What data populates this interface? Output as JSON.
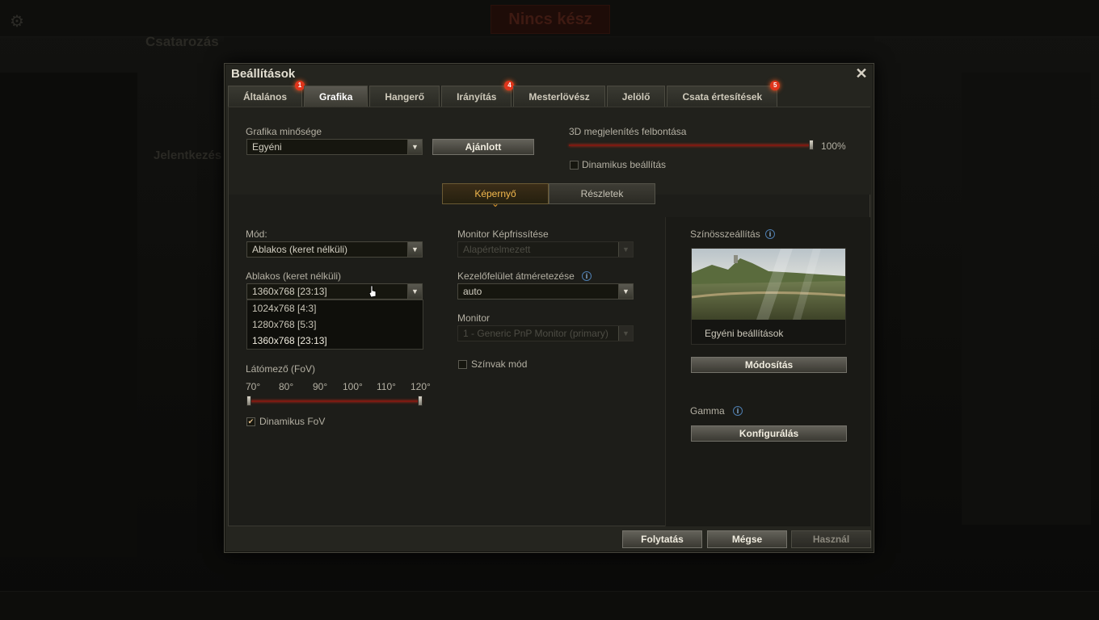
{
  "dialog": {
    "title": "Beállítások",
    "close_label": "✕"
  },
  "tabs": [
    {
      "label": "Általános",
      "badge": "1",
      "active": false
    },
    {
      "label": "Grafika",
      "badge": "",
      "active": true
    },
    {
      "label": "Hangerő",
      "badge": "",
      "active": false
    },
    {
      "label": "Irányítás",
      "badge": "4",
      "active": false
    },
    {
      "label": "Mesterlövész",
      "badge": "",
      "active": false
    },
    {
      "label": "Jelölő",
      "badge": "",
      "active": false
    },
    {
      "label": "Csata értesítések",
      "badge": "5",
      "active": false
    }
  ],
  "quality": {
    "label": "Grafika minősége",
    "value": "Egyéni",
    "recommended_button": "Ajánlott"
  },
  "resolution3d": {
    "label": "3D megjelenítés felbontása",
    "value_percent": 100,
    "value_text": "100%",
    "dynamic_label": "Dinamikus beállítás",
    "dynamic_checked": false
  },
  "subtabs": [
    "Képernyő",
    "Részletek"
  ],
  "mode": {
    "label": "Mód:",
    "value": "Ablakos (keret nélküli)"
  },
  "window_res": {
    "label": "Ablakos (keret nélküli)",
    "value": "1360x768 [23:13]",
    "options": [
      "1024x768 [4:3]",
      "1280x768 [5:3]",
      "1360x768 [23:13]"
    ]
  },
  "fov": {
    "label": "Látómező (FoV)",
    "ticks": [
      "70°",
      "80°",
      "90°",
      "100°",
      "110°",
      "120°"
    ],
    "range": [
      70,
      120
    ],
    "dynamic_label": "Dinamikus FoV",
    "dynamic_checked": true,
    "dynamic_mark": "✔"
  },
  "refresh": {
    "label": "Monitor Képfrissítése",
    "value": "Alapértelmezett"
  },
  "ui_scale": {
    "label": "Kezelőfelület átméretezése",
    "value": "auto"
  },
  "monitor": {
    "label": "Monitor",
    "value": "1 - Generic PnP Monitor (primary)"
  },
  "colorblind": {
    "label": "Színvak mód",
    "checked": false
  },
  "color_settings": {
    "label": "Színösszeállítás",
    "preview_caption": "Egyéni beállítások",
    "modify_button": "Módosítás"
  },
  "gamma": {
    "label": "Gamma",
    "configure_button": "Konfigurálás"
  },
  "info_glyph": "i",
  "footer": {
    "continue": "Folytatás",
    "cancel": "Mégse",
    "apply": "Használ"
  },
  "background": {
    "ready_button": "Nincs kész",
    "battle_label": "Csatarozás",
    "report_label": "Jelentkezés"
  },
  "colors": {
    "accent_orange": "#f2b84d",
    "slider_red": "#7c1a12",
    "badge_red": "#e0341b"
  }
}
